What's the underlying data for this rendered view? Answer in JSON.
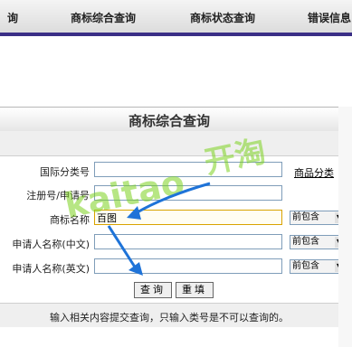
{
  "nav": {
    "items": [
      "询",
      "商标综合查询",
      "商标状态查询",
      "错误信息"
    ]
  },
  "form": {
    "title": "商标综合查询",
    "fields": [
      {
        "label": "国际分类号",
        "value": "",
        "side_link": "商品分类"
      },
      {
        "label": "注册号/申请号",
        "value": ""
      },
      {
        "label": "商标名称",
        "value": "百图",
        "select": "前包含"
      },
      {
        "label": "申请人名称(中文)",
        "value": "",
        "select": "前包含"
      },
      {
        "label": "申请人名称(英文)",
        "value": "",
        "select": "前包含"
      }
    ],
    "buttons": {
      "query": "查询",
      "reset": "重填"
    },
    "note": "输入相关内容提交查询，只输入类号是不可以查询的。"
  },
  "watermark": {
    "brand": "kaitao",
    "cn": "开淘"
  },
  "colors": {
    "nav_border": "#3a2e86",
    "arrow": "#1e73d8",
    "watermark": "#7ed321"
  }
}
